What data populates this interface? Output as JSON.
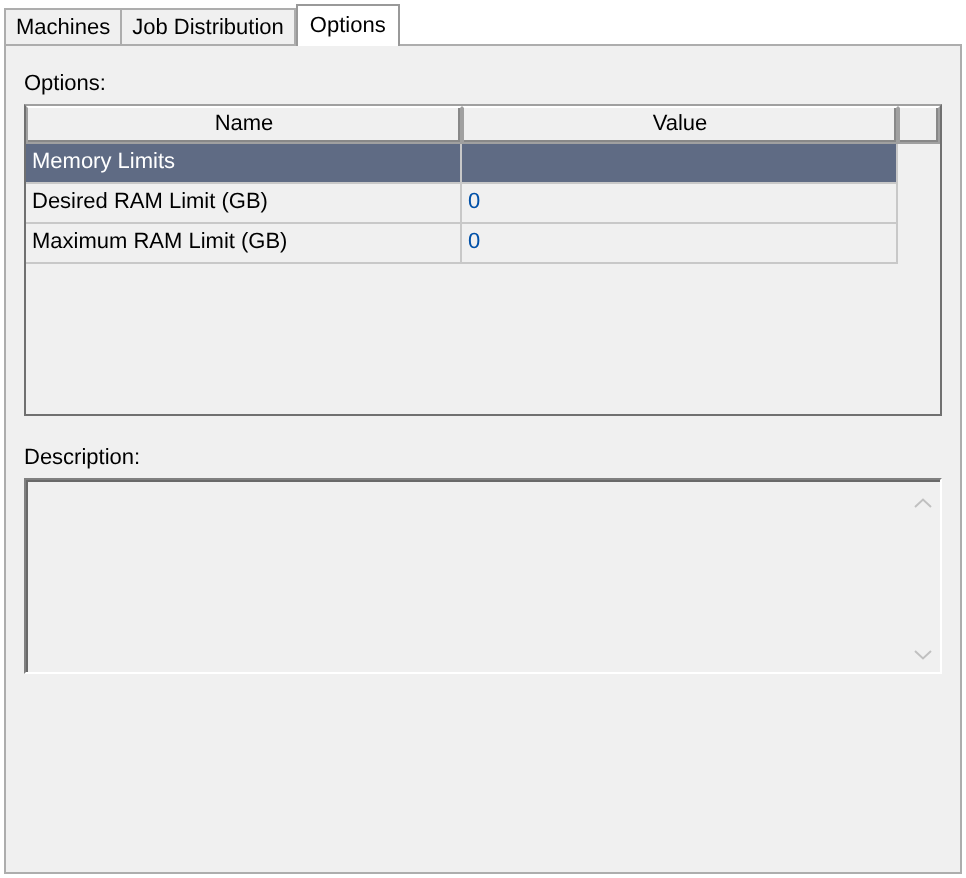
{
  "tabs": [
    {
      "label": "Machines",
      "selected": false
    },
    {
      "label": "Job Distribution",
      "selected": false
    },
    {
      "label": "Options",
      "selected": true
    }
  ],
  "options": {
    "label": "Options:",
    "columns": [
      "Name",
      "Value"
    ],
    "rows": [
      {
        "kind": "category",
        "name": "Memory Limits",
        "selected": true
      },
      {
        "kind": "property",
        "name": "Desired RAM Limit (GB)",
        "value": "0",
        "selected": false
      },
      {
        "kind": "property",
        "name": "Maximum RAM Limit (GB)",
        "value": "0",
        "selected": false
      }
    ]
  },
  "description": {
    "label": "Description:"
  }
}
